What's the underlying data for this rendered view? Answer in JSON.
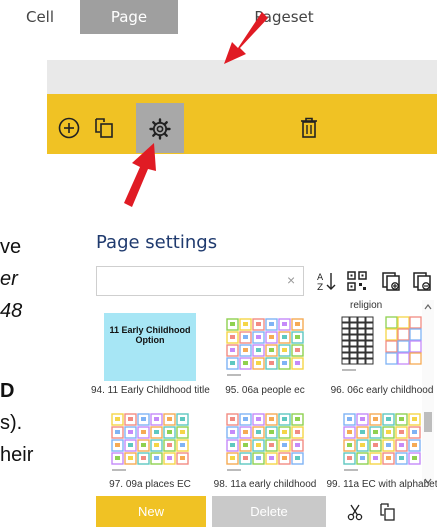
{
  "tabs": {
    "cell": "Cell",
    "page": "Page",
    "pageset": "Pageset"
  },
  "side_text": [
    "ve",
    "er",
    "48",
    "D",
    "s).",
    "heir"
  ],
  "panel": {
    "title": "Page settings",
    "search_clear": "×",
    "top_label": "religion",
    "tiles": [
      {
        "thumb_title": "11 Early Childhood Option",
        "label": "94. 11 Early Childhood title"
      },
      {
        "label": "95. 06a people ec"
      },
      {
        "label": "96. 06c early childhood"
      },
      {
        "label": "97. 09a places EC"
      },
      {
        "label": "98. 11a early childhood"
      },
      {
        "label": "99. 11a EC with alphabet"
      }
    ],
    "new_label": "New",
    "delete_label": "Delete"
  },
  "colors": {
    "accent": "#f0c224",
    "tab_active": "#9f9f9f",
    "arrow": "#e01b24",
    "title": "#1f3a6e",
    "thumb_blue": "#a7e6f5"
  }
}
